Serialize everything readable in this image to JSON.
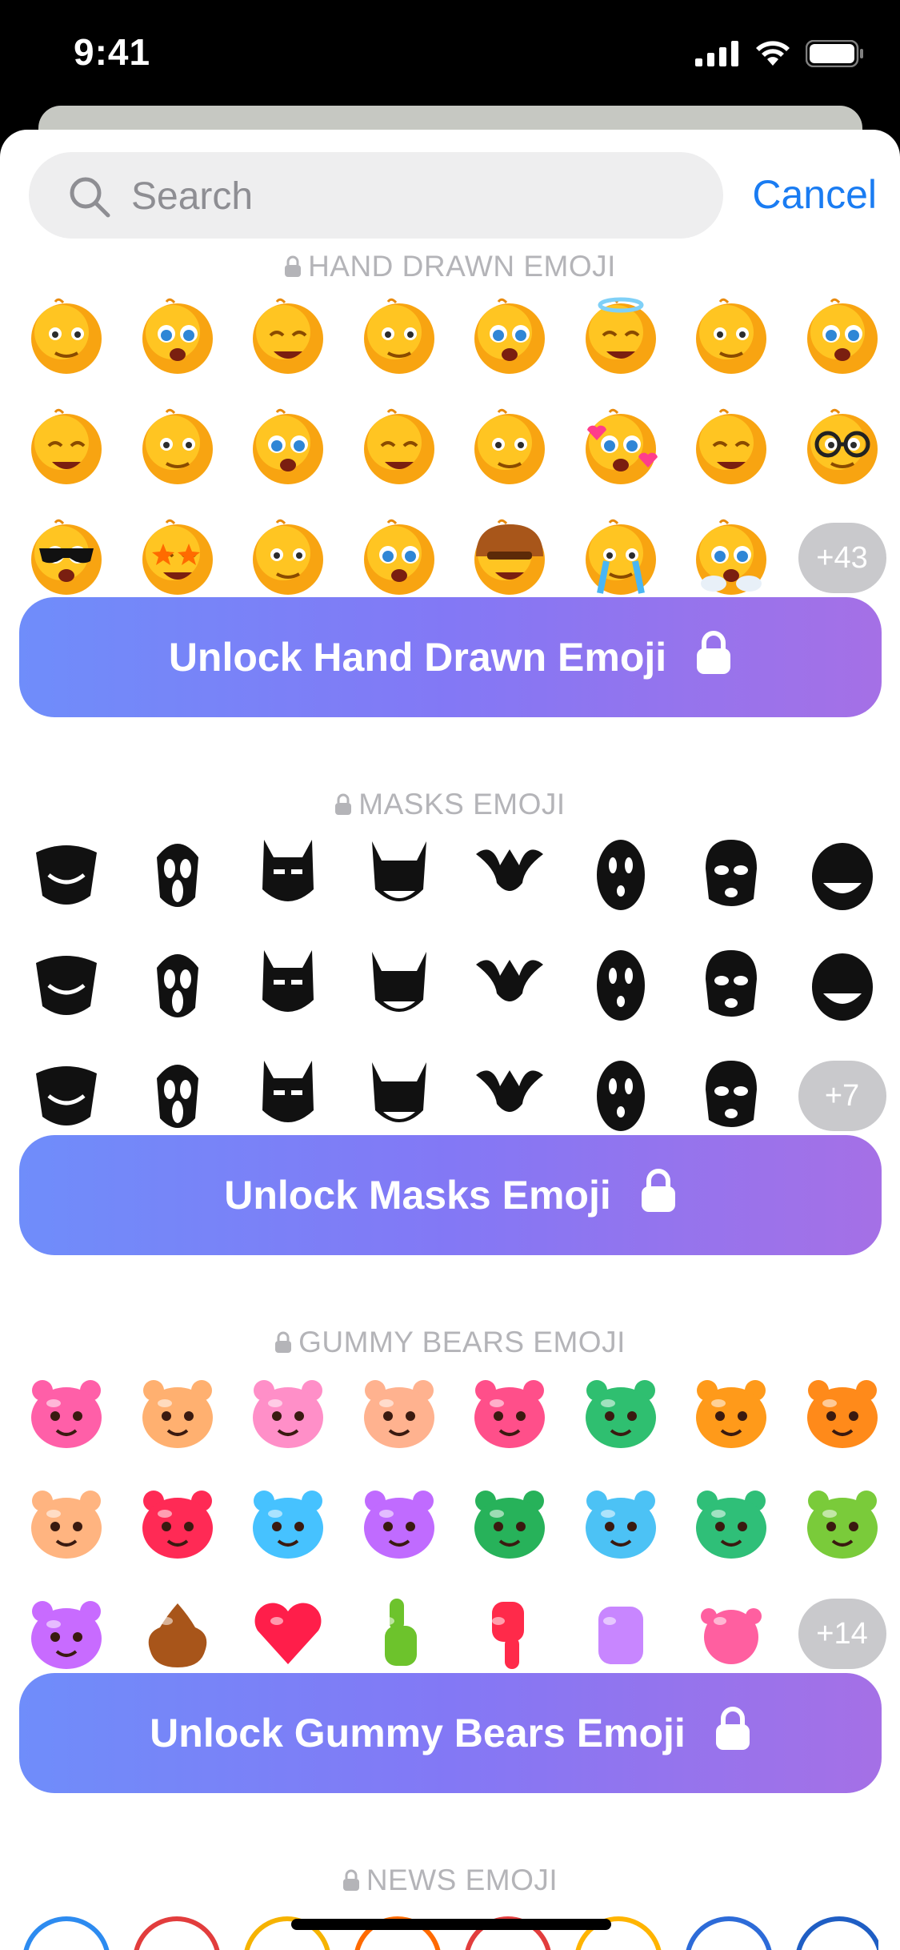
{
  "status_bar": {
    "time": "9:41"
  },
  "search": {
    "placeholder": "Search",
    "value": "",
    "cancel_label": "Cancel"
  },
  "colors": {
    "accent": "#1a7cf2",
    "gradient": [
      "#6f8dfa",
      "#8378f5",
      "#a570e6"
    ],
    "section_title": "#b4b4b8",
    "more_pill": "#c9c9cc"
  },
  "sections": [
    {
      "title": "HAND DRAWN EMOJI",
      "more": "+43",
      "button_label": "Unlock Hand Drawn Emoji",
      "emojis": [
        "grin-braces-icon",
        "teary-eyes-icon",
        "sweat-smile-icon",
        "laughing-icon",
        "crying-icon",
        "halo-icon",
        "blush-icon",
        "wink-icon",
        "surprised-icon",
        "face-palm-icon",
        "relieved-icon",
        "hand-over-eye-icon",
        "tongue-out-icon",
        "hearts-icon",
        "big-eyes-icon",
        "nerd-glasses-icon",
        "sunglasses-icon",
        "star-eyes-icon",
        "party-icon",
        "eye-roll-icon",
        "helmet-icon",
        "sobbing-icon",
        "steam-icon"
      ]
    },
    {
      "title": "MASKS EMOJI",
      "more": "+7",
      "button_label": "Unlock Masks Emoji",
      "emojis": [
        "guy-fawkes-mask-icon",
        "ghostface-mask-icon",
        "bat-mask-icon",
        "devil-mask-icon",
        "jester-mask-icon",
        "noface-mask-icon",
        "ski-mask-icon",
        "grin-mask-icon",
        "plague-doctor-icon",
        "gas-mask-icon",
        "pumpkin-mask-icon",
        "diver-helmet-icon",
        "robot-helmet-icon",
        "fox-mask-icon",
        "theater-mask-icon",
        "cyclops-mask-icon",
        "cat-helmet-icon",
        "reaper-icon",
        "puppet-mask-icon",
        "oni-mask-icon",
        "smile-ghost-icon",
        "hood-icon",
        "samurai-skull-icon"
      ]
    },
    {
      "title": "GUMMY BEARS EMOJI",
      "more": "+14",
      "button_label": "Unlock Gummy Bears Emoji",
      "emojis": [
        "pink-bear-grin-icon",
        "peach-bear-sweat-icon",
        "pink-bear-blush-icon",
        "heart-eyes-bear-icon",
        "kiss-bear-icon",
        "star-eyes-bear-icon",
        "party-bear-icon",
        "orange-bear-smirk-icon",
        "crying-bear-icon",
        "angry-bear-icon",
        "shocked-bear-icon",
        "purple-bear-annoyed-icon",
        "dizzy-bear-icon",
        "blue-bear-kiss-icon",
        "green-bear-dizzy-icon",
        "lime-bear-sick-icon",
        "purple-devil-bear-icon",
        "poop-gummy-icon",
        "heart-gummy-icon",
        "thumbs-up-gummy-icon",
        "thumbs-down-gummy-icon",
        "fist-gummy-icon",
        "ok-hand-gummy-icon"
      ]
    },
    {
      "title": "NEWS EMOJI"
    }
  ]
}
